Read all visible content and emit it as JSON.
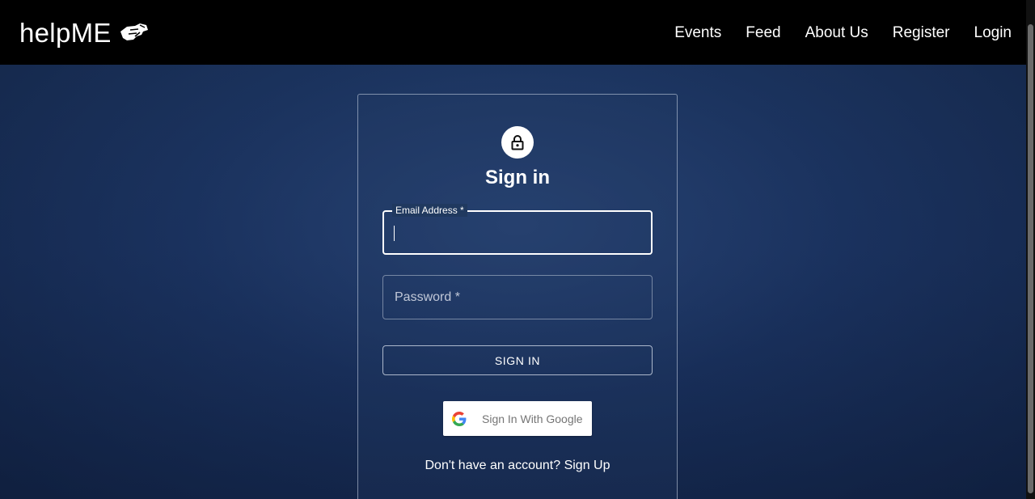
{
  "navbar": {
    "brand": "helpME",
    "links": [
      "Events",
      "Feed",
      "About Us",
      "Register",
      "Login"
    ]
  },
  "form": {
    "title": "Sign in",
    "email_label": "Email Address *",
    "email_value": "",
    "password_label": "Password *",
    "password_value": "",
    "signin_button": "SIGN IN",
    "google_button": "Sign In With Google",
    "signup_prompt": "Don't have an account?",
    "signup_link": "Sign Up"
  },
  "colors": {
    "navbar_bg": "#000000",
    "page_bg": "#1a2f55",
    "text": "#ffffff",
    "google_text": "#757575"
  },
  "icons": {
    "brand": "helping-hands-icon",
    "lock": "lock-icon",
    "google": "google-g-icon"
  }
}
